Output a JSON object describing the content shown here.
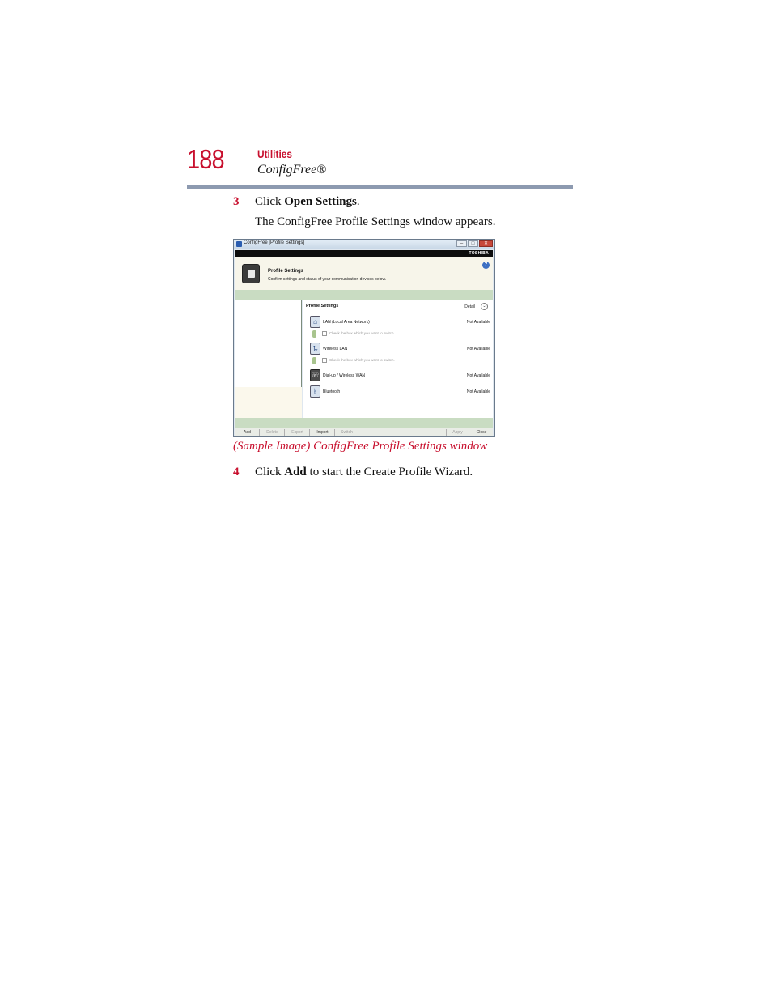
{
  "header": {
    "page_number": "188",
    "section": "Utilities",
    "subsection": "ConfigFree®"
  },
  "steps": [
    {
      "num": "3",
      "pre": "Click ",
      "bold": "Open Settings",
      "post": "."
    },
    {
      "num": "4",
      "pre": "Click ",
      "bold": "Add",
      "post": " to start the Create Profile Wizard."
    }
  ],
  "step3_note": "The ConfigFree Profile Settings window appears.",
  "screenshot": {
    "window_title": "ConfigFree [Profile Settings]",
    "brand": "TOSHIBA",
    "banner_title": "Profile Settings",
    "banner_desc": "Confirm settings and status of your communication devices below.",
    "pane_title": "Profile Settings",
    "detail_label": "Detail",
    "devices": [
      {
        "name": "LAN (Local Area Network)",
        "status": "Not Available",
        "icon": "lan-icon",
        "glyph": "⌂"
      },
      {
        "name": "Wireless LAN",
        "status": "Not Available",
        "icon": "wireless-lan-icon",
        "glyph": "⇅"
      },
      {
        "name": "Dial-up / Wireless WAN",
        "status": "Not Available",
        "icon": "dialup-icon",
        "glyph": "☏"
      },
      {
        "name": "Bluetooth",
        "status": "Not Available",
        "icon": "bluetooth-icon",
        "glyph": "ᛒ"
      }
    ],
    "switch_hint": "Check the box which you want to switch.",
    "buttons": {
      "add": "Add",
      "delete": "Delete",
      "export": "Export",
      "import": "Import",
      "switch": "Switch",
      "apply": "Apply",
      "close": "Close"
    }
  },
  "caption": "(Sample Image) ConfigFree Profile Settings window"
}
